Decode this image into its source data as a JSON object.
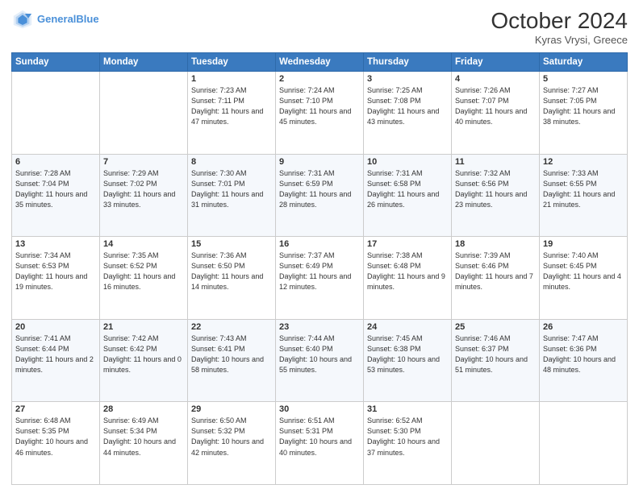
{
  "header": {
    "logo_line1": "General",
    "logo_line2": "Blue",
    "month_title": "October 2024",
    "subtitle": "Kyras Vrysi, Greece"
  },
  "days_of_week": [
    "Sunday",
    "Monday",
    "Tuesday",
    "Wednesday",
    "Thursday",
    "Friday",
    "Saturday"
  ],
  "weeks": [
    [
      {
        "day": "",
        "info": ""
      },
      {
        "day": "",
        "info": ""
      },
      {
        "day": "1",
        "info": "Sunrise: 7:23 AM\nSunset: 7:11 PM\nDaylight: 11 hours and 47 minutes."
      },
      {
        "day": "2",
        "info": "Sunrise: 7:24 AM\nSunset: 7:10 PM\nDaylight: 11 hours and 45 minutes."
      },
      {
        "day": "3",
        "info": "Sunrise: 7:25 AM\nSunset: 7:08 PM\nDaylight: 11 hours and 43 minutes."
      },
      {
        "day": "4",
        "info": "Sunrise: 7:26 AM\nSunset: 7:07 PM\nDaylight: 11 hours and 40 minutes."
      },
      {
        "day": "5",
        "info": "Sunrise: 7:27 AM\nSunset: 7:05 PM\nDaylight: 11 hours and 38 minutes."
      }
    ],
    [
      {
        "day": "6",
        "info": "Sunrise: 7:28 AM\nSunset: 7:04 PM\nDaylight: 11 hours and 35 minutes."
      },
      {
        "day": "7",
        "info": "Sunrise: 7:29 AM\nSunset: 7:02 PM\nDaylight: 11 hours and 33 minutes."
      },
      {
        "day": "8",
        "info": "Sunrise: 7:30 AM\nSunset: 7:01 PM\nDaylight: 11 hours and 31 minutes."
      },
      {
        "day": "9",
        "info": "Sunrise: 7:31 AM\nSunset: 6:59 PM\nDaylight: 11 hours and 28 minutes."
      },
      {
        "day": "10",
        "info": "Sunrise: 7:31 AM\nSunset: 6:58 PM\nDaylight: 11 hours and 26 minutes."
      },
      {
        "day": "11",
        "info": "Sunrise: 7:32 AM\nSunset: 6:56 PM\nDaylight: 11 hours and 23 minutes."
      },
      {
        "day": "12",
        "info": "Sunrise: 7:33 AM\nSunset: 6:55 PM\nDaylight: 11 hours and 21 minutes."
      }
    ],
    [
      {
        "day": "13",
        "info": "Sunrise: 7:34 AM\nSunset: 6:53 PM\nDaylight: 11 hours and 19 minutes."
      },
      {
        "day": "14",
        "info": "Sunrise: 7:35 AM\nSunset: 6:52 PM\nDaylight: 11 hours and 16 minutes."
      },
      {
        "day": "15",
        "info": "Sunrise: 7:36 AM\nSunset: 6:50 PM\nDaylight: 11 hours and 14 minutes."
      },
      {
        "day": "16",
        "info": "Sunrise: 7:37 AM\nSunset: 6:49 PM\nDaylight: 11 hours and 12 minutes."
      },
      {
        "day": "17",
        "info": "Sunrise: 7:38 AM\nSunset: 6:48 PM\nDaylight: 11 hours and 9 minutes."
      },
      {
        "day": "18",
        "info": "Sunrise: 7:39 AM\nSunset: 6:46 PM\nDaylight: 11 hours and 7 minutes."
      },
      {
        "day": "19",
        "info": "Sunrise: 7:40 AM\nSunset: 6:45 PM\nDaylight: 11 hours and 4 minutes."
      }
    ],
    [
      {
        "day": "20",
        "info": "Sunrise: 7:41 AM\nSunset: 6:44 PM\nDaylight: 11 hours and 2 minutes."
      },
      {
        "day": "21",
        "info": "Sunrise: 7:42 AM\nSunset: 6:42 PM\nDaylight: 11 hours and 0 minutes."
      },
      {
        "day": "22",
        "info": "Sunrise: 7:43 AM\nSunset: 6:41 PM\nDaylight: 10 hours and 58 minutes."
      },
      {
        "day": "23",
        "info": "Sunrise: 7:44 AM\nSunset: 6:40 PM\nDaylight: 10 hours and 55 minutes."
      },
      {
        "day": "24",
        "info": "Sunrise: 7:45 AM\nSunset: 6:38 PM\nDaylight: 10 hours and 53 minutes."
      },
      {
        "day": "25",
        "info": "Sunrise: 7:46 AM\nSunset: 6:37 PM\nDaylight: 10 hours and 51 minutes."
      },
      {
        "day": "26",
        "info": "Sunrise: 7:47 AM\nSunset: 6:36 PM\nDaylight: 10 hours and 48 minutes."
      }
    ],
    [
      {
        "day": "27",
        "info": "Sunrise: 6:48 AM\nSunset: 5:35 PM\nDaylight: 10 hours and 46 minutes."
      },
      {
        "day": "28",
        "info": "Sunrise: 6:49 AM\nSunset: 5:34 PM\nDaylight: 10 hours and 44 minutes."
      },
      {
        "day": "29",
        "info": "Sunrise: 6:50 AM\nSunset: 5:32 PM\nDaylight: 10 hours and 42 minutes."
      },
      {
        "day": "30",
        "info": "Sunrise: 6:51 AM\nSunset: 5:31 PM\nDaylight: 10 hours and 40 minutes."
      },
      {
        "day": "31",
        "info": "Sunrise: 6:52 AM\nSunset: 5:30 PM\nDaylight: 10 hours and 37 minutes."
      },
      {
        "day": "",
        "info": ""
      },
      {
        "day": "",
        "info": ""
      }
    ]
  ]
}
